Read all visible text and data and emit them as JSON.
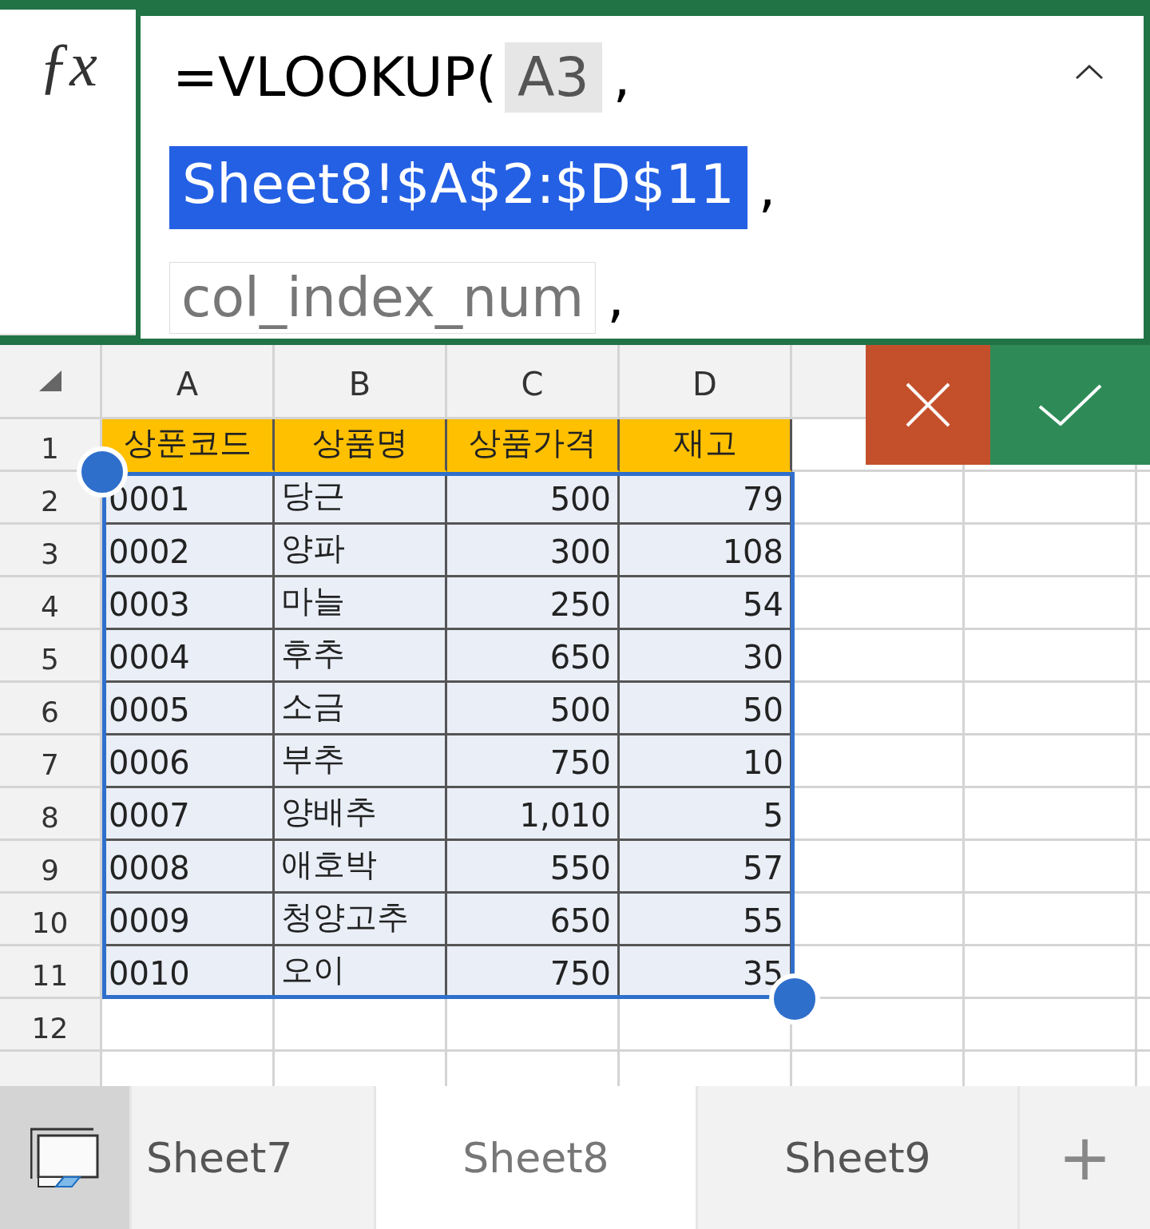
{
  "formula_bar": {
    "function_icon": "ƒx",
    "lines": [
      [
        {
          "text": "=VLOOKUP(",
          "kind": "plain"
        },
        {
          "text": "A3",
          "kind": "ref"
        },
        {
          "text": ",",
          "kind": "sep"
        }
      ],
      [
        {
          "text": "Sheet8!$A$2:$D$11",
          "kind": "selected"
        },
        {
          "text": ",",
          "kind": "sep"
        }
      ],
      [
        {
          "text": "col_index_num",
          "kind": "hint"
        },
        {
          "text": ",",
          "kind": "sep"
        }
      ]
    ]
  },
  "columns": [
    {
      "label": "A",
      "kind": "text"
    },
    {
      "label": "B",
      "kind": "text"
    },
    {
      "label": "C",
      "kind": "number"
    },
    {
      "label": "D",
      "kind": "number"
    }
  ],
  "rows": [
    {
      "header": "1",
      "kind": "title",
      "selected": false,
      "cells": [
        "상푼코드",
        "상품명",
        "상품가격",
        "재고"
      ]
    },
    {
      "header": "2",
      "kind": "data",
      "selected": true,
      "cells": [
        "0001",
        "당근",
        "500",
        "79"
      ]
    },
    {
      "header": "3",
      "kind": "data",
      "selected": true,
      "cells": [
        "0002",
        "양파",
        "300",
        "108"
      ]
    },
    {
      "header": "4",
      "kind": "data",
      "selected": true,
      "cells": [
        "0003",
        "마늘",
        "250",
        "54"
      ]
    },
    {
      "header": "5",
      "kind": "data",
      "selected": true,
      "cells": [
        "0004",
        "후추",
        "650",
        "30"
      ]
    },
    {
      "header": "6",
      "kind": "data",
      "selected": true,
      "cells": [
        "0005",
        "소금",
        "500",
        "50"
      ]
    },
    {
      "header": "7",
      "kind": "data",
      "selected": true,
      "cells": [
        "0006",
        "부추",
        "750",
        "10"
      ]
    },
    {
      "header": "8",
      "kind": "data",
      "selected": true,
      "cells": [
        "0007",
        "양배추",
        "1,010",
        "5"
      ]
    },
    {
      "header": "9",
      "kind": "data",
      "selected": true,
      "cells": [
        "0008",
        "애호박",
        "550",
        "57"
      ]
    },
    {
      "header": "10",
      "kind": "data",
      "selected": true,
      "cells": [
        "0009",
        "청양고추",
        "650",
        "55"
      ]
    },
    {
      "header": "11",
      "kind": "data",
      "selected": true,
      "cells": [
        "0010",
        "오이",
        "750",
        "35"
      ]
    },
    {
      "header": "12",
      "kind": "data",
      "selected": false
    }
  ],
  "sheet_tabs": [
    {
      "label": "Sheet7",
      "selected": false
    },
    {
      "label": "Sheet8",
      "selected": true
    },
    {
      "label": "Sheet9",
      "selected": false
    }
  ],
  "add_sheet": "+"
}
